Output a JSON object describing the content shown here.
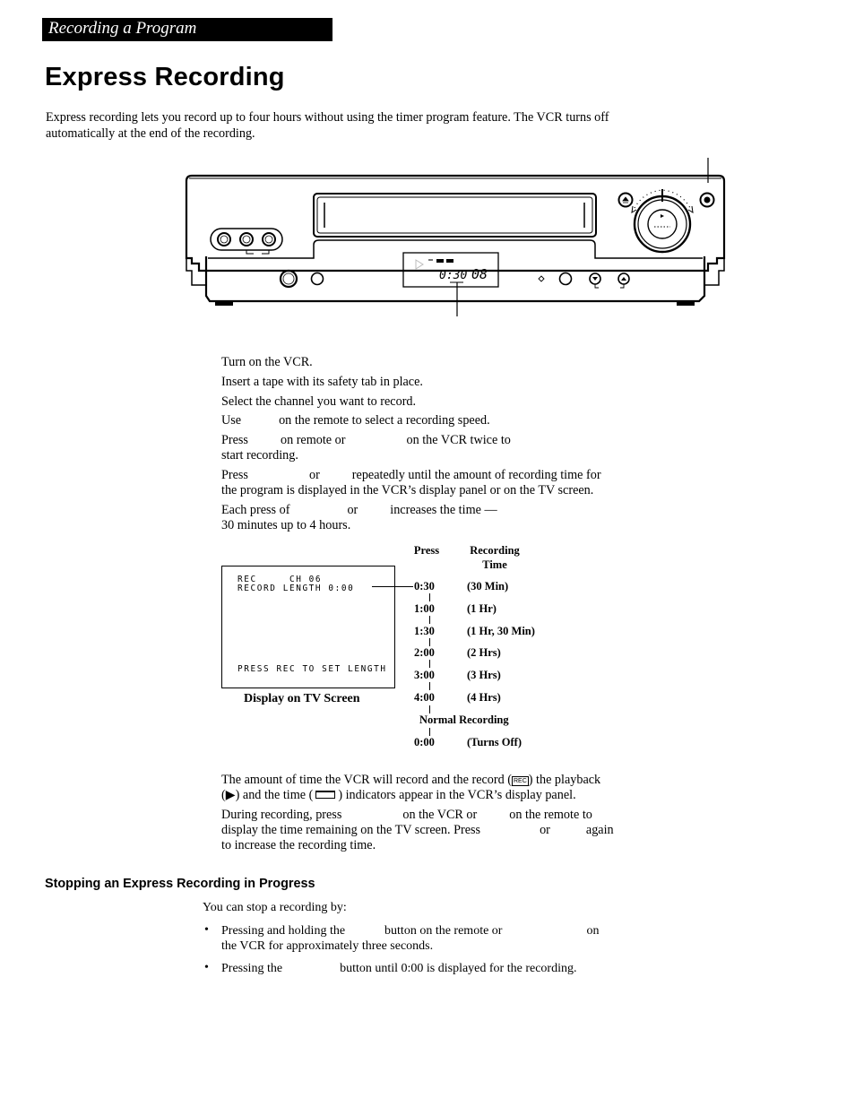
{
  "header": {
    "section": "Recording a Program",
    "title": "Express Recording"
  },
  "intro": "Express recording lets you record up to four hours without using the timer program feature.  The VCR turns off automatically at the end of the recording.",
  "vcr_illustration": {
    "display_time": "0:30",
    "display_channel": "08"
  },
  "steps": {
    "s1": "Turn on the VCR.",
    "s2": "Insert a tape with its safety tab in place.",
    "s3": "Select the channel you want to record.",
    "s4": {
      "a": "Use",
      "b": "on the remote to select a recording speed."
    },
    "s5": {
      "a": "Press",
      "b": "on remote or",
      "c": "on the VCR twice to",
      "d": "start recording."
    },
    "s6": {
      "a": "Press",
      "b": "or",
      "c": "repeatedly until the amount of recording time for",
      "d": "the program is displayed in the VCR’s display panel or on the TV screen."
    },
    "s7": {
      "a": "Each press of",
      "b": "or",
      "c": "increases the time —",
      "d": "30 minutes up to 4 hours."
    }
  },
  "tv_screen": {
    "line1": "REC     CH 06",
    "line2": "RECORD LENGTH 0:00",
    "line3": "PRESS REC TO SET LENGTH",
    "caption": "Display on TV Screen"
  },
  "press_table": {
    "col_press": "Press",
    "col_time_1": "Recording",
    "col_time_2": "Time",
    "rows": [
      {
        "press": "0:30",
        "time": "(30 Min)"
      },
      {
        "press": "1:00",
        "time": "(1 Hr)"
      },
      {
        "press": "1:30",
        "time": "(1 Hr, 30 Min)"
      },
      {
        "press": "2:00",
        "time": "(2 Hrs)"
      },
      {
        "press": "3:00",
        "time": "(3 Hrs)"
      },
      {
        "press": "4:00",
        "time": "(4 Hrs)"
      }
    ],
    "normal": "Normal Recording",
    "off_press": "0:00",
    "off_time": "(Turns Off)"
  },
  "notes": {
    "n1a": "The amount of time the VCR will record and the record (",
    "rec_badge": "REC",
    "n1b": ") the playback",
    "n1c": "(▶) and the time (",
    "n1d": ") indicators appear in the VCR’s display panel.",
    "n2a": "During recording, press",
    "n2b": "on the VCR or",
    "n2c": "on the remote to",
    "n2d": "display the time remaining on the TV screen. Press",
    "n2e": "or",
    "n2f": "again",
    "n2g": "to increase the recording time."
  },
  "stopping": {
    "heading": "Stopping an Express Recording in Progress",
    "lead": "You can stop a recording by:",
    "bullet": "•",
    "b1a": "Pressing and holding the",
    "b1b": "button on the remote or",
    "b1c": "on",
    "b1d": "the VCR for approximately three seconds.",
    "b2a": "Pressing the",
    "b2b": "button until 0:00 is displayed for the recording."
  }
}
